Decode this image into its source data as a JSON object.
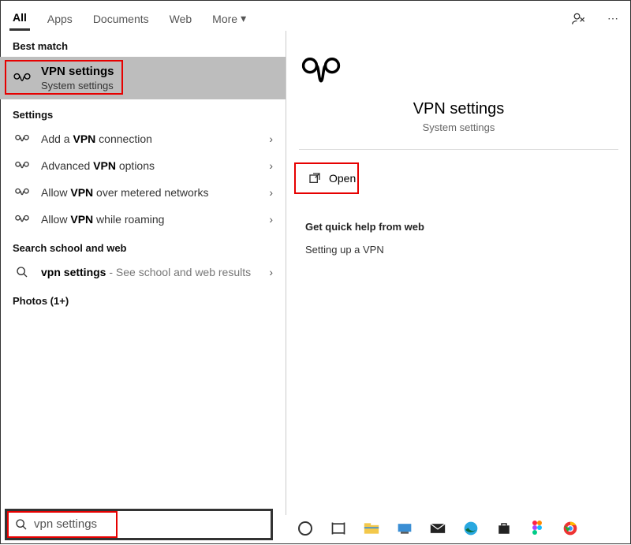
{
  "tabs": {
    "all": "All",
    "apps": "Apps",
    "documents": "Documents",
    "web": "Web",
    "more": "More"
  },
  "headings": {
    "best_match": "Best match",
    "settings": "Settings",
    "search_web": "Search school and web",
    "photos": "Photos (1+)"
  },
  "best": {
    "title": "VPN settings",
    "subtitle": "System settings"
  },
  "settings_items": {
    "0": {
      "pre": "Add a ",
      "bold": "VPN",
      "post": " connection"
    },
    "1": {
      "pre": "Advanced ",
      "bold": "VPN",
      "post": " options"
    },
    "2": {
      "pre": "Allow ",
      "bold": "VPN",
      "post": " over metered networks"
    },
    "3": {
      "pre": "Allow ",
      "bold": "VPN",
      "post": " while roaming"
    }
  },
  "web_item": {
    "bold": "vpn settings",
    "suffix": " - See school and web results"
  },
  "preview": {
    "title": "VPN settings",
    "subtitle": "System settings",
    "open": "Open"
  },
  "help": {
    "heading": "Get quick help from web",
    "link": "Setting up a VPN"
  },
  "search": {
    "value": "vpn settings"
  }
}
